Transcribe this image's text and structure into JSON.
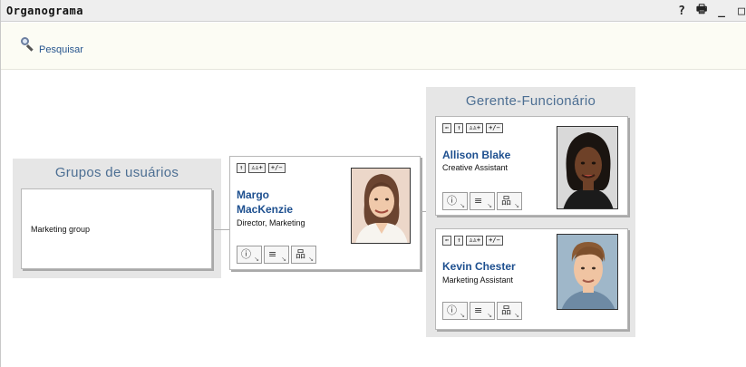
{
  "window": {
    "title": "Organograma",
    "icons": [
      "help-icon",
      "print-icon",
      "minimize-icon",
      "maximize-icon"
    ],
    "icon_glyphs": [
      "?",
      "🖶",
      "_",
      "□"
    ]
  },
  "toolbar": {
    "search_label": "Pesquisar"
  },
  "groups_panel": {
    "title": "Grupos de usuários",
    "group_name": "Marketing group"
  },
  "center_card": {
    "name_line1": "Margo",
    "name_line2": "MacKenzie",
    "role": "Director, Marketing",
    "nav_buttons": [
      "↑",
      "♙♙+",
      "+/−"
    ]
  },
  "manager_panel": {
    "title": "Gerente-Funcionário",
    "employees": [
      {
        "name": "Allison Blake",
        "role": "Creative Assistant",
        "nav_buttons": [
          "⇐",
          "↑",
          "♙♙+",
          "+/−"
        ]
      },
      {
        "name": "Kevin Chester",
        "role": "Marketing Assistant",
        "nav_buttons": [
          "⇐",
          "↑",
          "♙♙+",
          "+/−"
        ]
      }
    ]
  },
  "action_buttons": [
    "ⓘ",
    "≡",
    "品"
  ],
  "colors": {
    "accent": "#1d4f8f",
    "panel_title": "#4d6f93",
    "panel_bg": "#e6e6e6"
  }
}
